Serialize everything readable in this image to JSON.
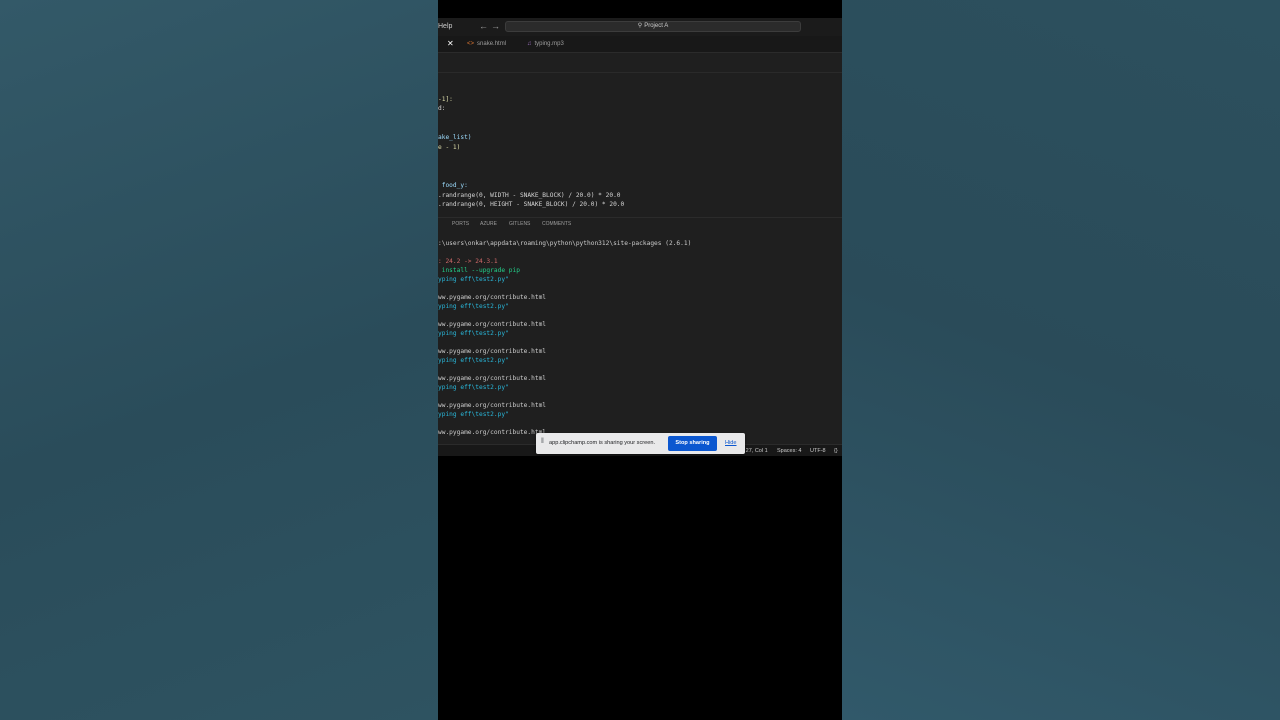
{
  "titlebar": {
    "menu_fragment": "Help",
    "back_icon": "arrow-left-icon",
    "forward_icon": "arrow-right-icon",
    "search_icon": "search-icon",
    "search_text": "Project A"
  },
  "tabs": [
    {
      "label": "snake.html",
      "icon": "html-file-icon",
      "color": "#e37933"
    },
    {
      "label": "typing.mp3",
      "icon": "audio-file-icon",
      "color": "#a074c4"
    }
  ],
  "editor": {
    "lines": [
      {
        "text": "-1]:",
        "cls": "c-yel"
      },
      {
        "text": "d:",
        "cls": "c-wht"
      },
      {
        "text": "ake_list)",
        "cls": "c-var"
      },
      {
        "text": "e - 1)",
        "cls": "c-yel"
      },
      {
        "text": " food_y:",
        "cls": "c-var"
      },
      {
        "text": ".randrange(0, WIDTH - SNAKE_BLOCK) / 20.0) * 20.0",
        "cls": "c-wht"
      },
      {
        "text": ".randrange(0, HEIGHT - SNAKE_BLOCK) / 20.0) * 20.0",
        "cls": "c-wht"
      }
    ]
  },
  "panel_tabs": [
    "PORTS",
    "AZURE",
    "GITLENS",
    "COMMENTS"
  ],
  "terminal": {
    "lines": [
      ":\\users\\onkar\\appdata\\roaming\\python\\python312\\site-packages (2.6.1)",
      ": 24.2 -> 24.3.1",
      " install --upgrade pip",
      "yping eff\\test2.py\"",
      "ww.pygame.org/contribute.html",
      "yping eff\\test2.py\"",
      "ww.pygame.org/contribute.html",
      "yping eff\\test2.py\"",
      "ww.pygame.org/contribute.html",
      "yping eff\\test2.py\"",
      "ww.pygame.org/contribute.html",
      "yping eff\\test2.py\"",
      "ww.pygame.org/contribute.html",
      "yping eff\\test2.py\"",
      "ww.pygame.org/contribute.html"
    ]
  },
  "statusbar": {
    "position": "Ln 27, Col 1",
    "spaces": "Spaces: 4",
    "encoding": "UTF-8",
    "braces": "{}"
  },
  "share_bar": {
    "message": "app.clipchamp.com is sharing your screen.",
    "stop_label": "Stop sharing",
    "hide_label": "Hide"
  }
}
